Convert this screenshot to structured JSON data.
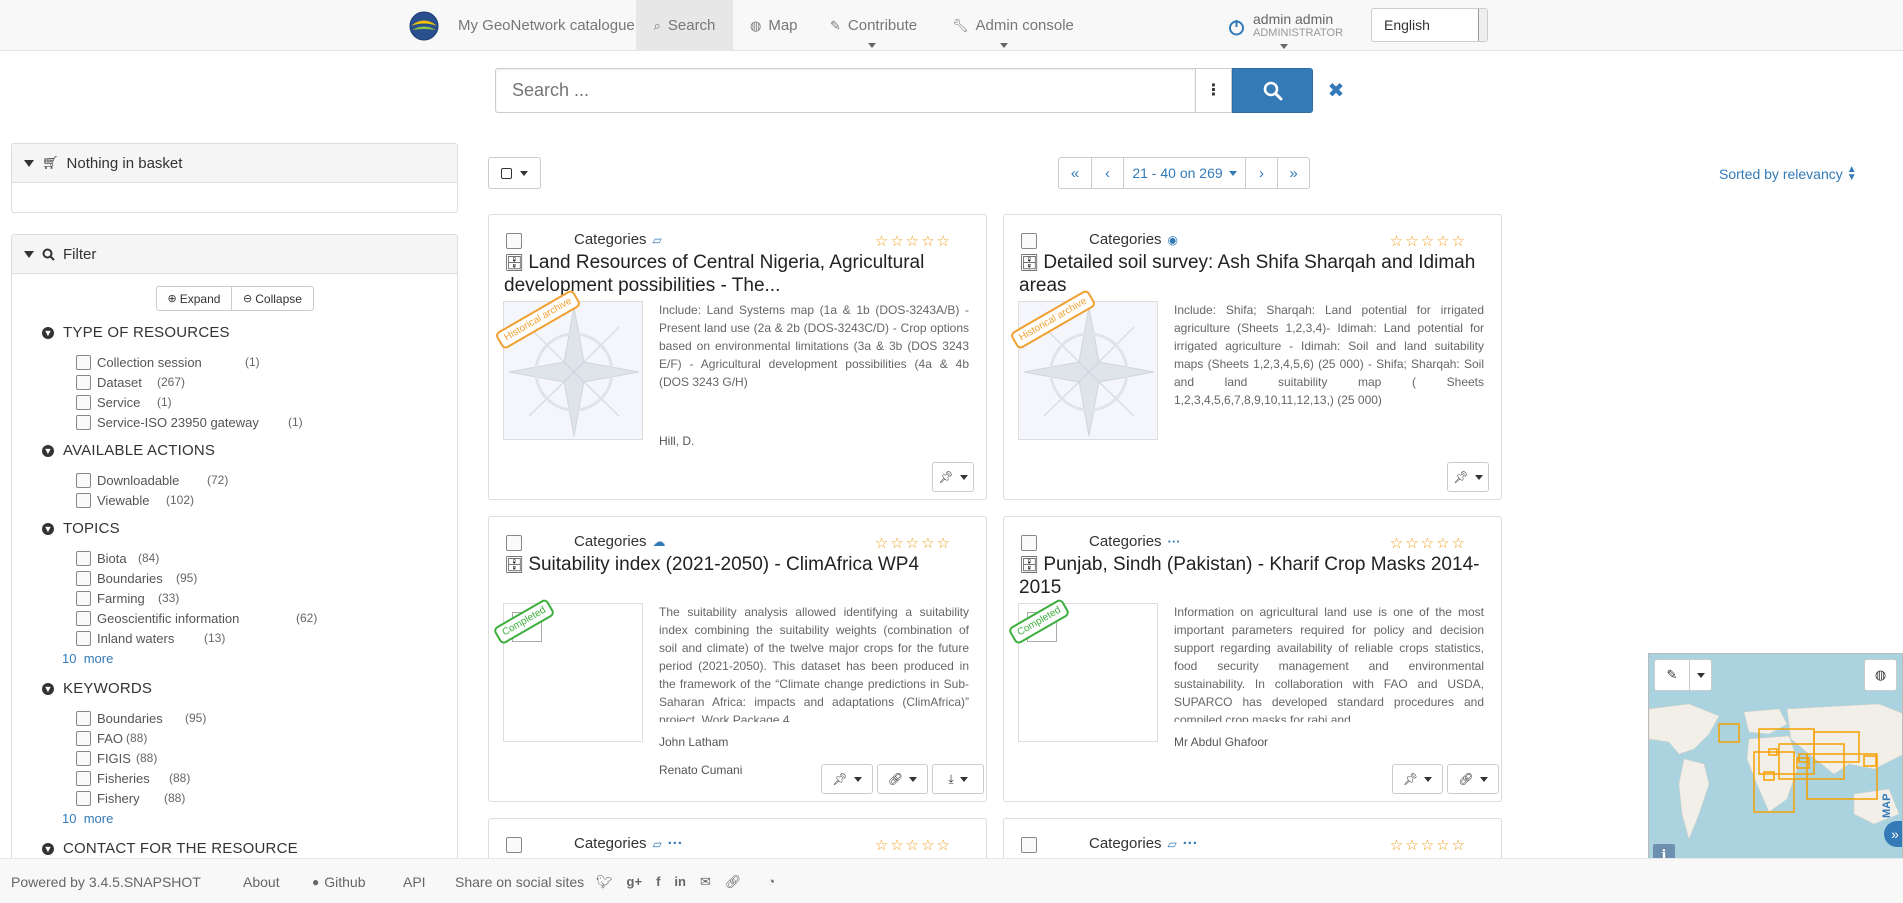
{
  "nav": {
    "catalogue": "My GeoNetwork catalogue",
    "search": "Search",
    "map": "Map",
    "contribute": "Contribute",
    "admin_console": "Admin console",
    "user_name": "admin admin",
    "user_role": "ADMINISTRATOR",
    "language": "English"
  },
  "search": {
    "placeholder": "Search ..."
  },
  "basket": {
    "label": "Nothing in basket"
  },
  "filter": {
    "label": "Filter",
    "expand": "Expand",
    "collapse": "Collapse",
    "facets": [
      {
        "title": "TYPE OF RESOURCES",
        "items": [
          {
            "label": "Collection session",
            "count": "(1)"
          },
          {
            "label": "Dataset",
            "count": "(267)"
          },
          {
            "label": "Service",
            "count": "(1)"
          },
          {
            "label": "Service-ISO 23950 gateway",
            "count": "(1)"
          }
        ]
      },
      {
        "title": "AVAILABLE ACTIONS",
        "items": [
          {
            "label": "Downloadable",
            "count": "(72)"
          },
          {
            "label": "Viewable",
            "count": "(102)"
          }
        ]
      },
      {
        "title": "TOPICS",
        "items": [
          {
            "label": "Biota",
            "count": "(84)"
          },
          {
            "label": "Boundaries",
            "count": "(95)"
          },
          {
            "label": "Farming",
            "count": "(33)"
          },
          {
            "label": "Geoscientific information",
            "count": "(62)"
          },
          {
            "label": "Inland waters",
            "count": "(13)"
          }
        ],
        "more_num": "10",
        "more": "more"
      },
      {
        "title": "KEYWORDS",
        "items": [
          {
            "label": "Boundaries",
            "count": "(95)"
          },
          {
            "label": "FAO",
            "count": "(88)"
          },
          {
            "label": "FIGIS",
            "count": "(88)"
          },
          {
            "label": "Fisheries",
            "count": "(88)"
          },
          {
            "label": "Fishery",
            "count": "(88)"
          }
        ],
        "more_num": "10",
        "more": "more"
      },
      {
        "title": "CONTACT FOR THE RESOURCE",
        "items": []
      }
    ]
  },
  "pager": {
    "first": "«",
    "prev": "‹",
    "range": "21 - 40 on 269",
    "next": "›",
    "last": "»"
  },
  "sort": {
    "label": "Sorted by relevancy"
  },
  "results": [
    {
      "categories": "Categories",
      "title": "Land Resources of Central Nigeria, Agricultural development possibilities - The...",
      "status": "Historical archive",
      "abstract": "Include: Land Systems map (1a & 1b (DOS-3243A/B) - Present land use (2a & 2b (DOS-3243C/D) - Crop options based on environmental limitations (3a & 3b (DOS 3243 E/F) - Agricultural development possibilities (4a & 4b (DOS 3243 G/H)",
      "authors": [
        "Hill, D."
      ]
    },
    {
      "categories": "Categories",
      "title": "Detailed soil survey: Ash Shifa Sharqah and Idimah areas",
      "status": "Historical archive",
      "abstract": "Include: Shifa; Sharqah: Land potential for irrigated agriculture (Sheets 1,2,3,4)- Idimah: Land potential for irrigated agriculture - Idimah: Soil and land suitability maps (Sheets 1,2,3,4,5,6) (25 000) - Shifa; Sharqah: Soil and land suitability map ( Sheets 1,2,3,4,5,6,7,8,9,10,11,12,13,) (25 000)",
      "authors": []
    },
    {
      "categories": "Categories",
      "title": "Suitability index (2021-2050) - ClimAfrica WP4",
      "status": "Completed",
      "abstract": "The suitability analysis allowed identifying a suitability index combining the suitability weights (combination of soil and climate) of the twelve major crops for the future period (2021-2050). This dataset has been produced in the framework of the “Climate change predictions in Sub-Saharan Africa: impacts and adaptations (ClimAfrica)” project, Work Package 4",
      "authors": [
        "John Latham",
        "Renato Cumani"
      ]
    },
    {
      "categories": "Categories",
      "title": "Punjab, Sindh (Pakistan) - Kharif Crop Masks 2014-2015",
      "status": "Completed",
      "abstract": "Information on agricultural land use is one of the most important parameters required for policy and decision support regarding availability of reliable crops statistics, food security management and environmental sustainability. In collaboration with FAO and USDA, SUPARCO has developed standard procedures and compiled crop masks for rabi and",
      "authors": [
        "Mr Abdul Ghafoor"
      ]
    },
    {
      "categories": "Categories"
    },
    {
      "categories": "Categories"
    }
  ],
  "footer": {
    "powered": "Powered by 3.4.5.SNAPSHOT",
    "about": "About",
    "github": "Github",
    "api": "API",
    "share": "Share on social sites"
  },
  "map": {
    "label": "MAP",
    "info": "i"
  },
  "colors": {
    "primary": "#337ab7",
    "archive": "#f0a030",
    "completed": "#3cae3c",
    "star": "#f0a020"
  }
}
